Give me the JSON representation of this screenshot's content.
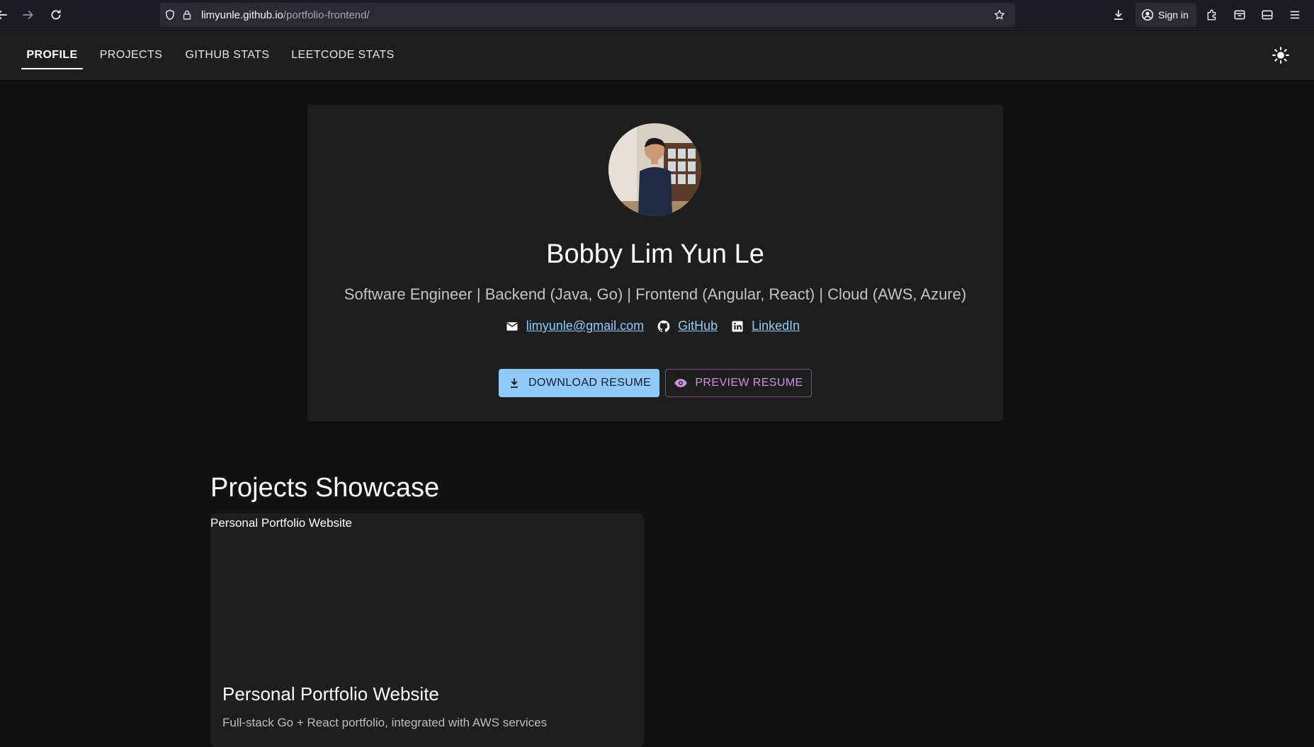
{
  "browser": {
    "url_domain": "limyunle.github.io",
    "url_path": "/portfolio-frontend/",
    "signin_label": "Sign in"
  },
  "nav": {
    "tabs": [
      {
        "label": "PROFILE",
        "active": true
      },
      {
        "label": "PROJECTS",
        "active": false
      },
      {
        "label": "GITHUB STATS",
        "active": false
      },
      {
        "label": "LEETCODE STATS",
        "active": false
      }
    ]
  },
  "profile": {
    "name": "Bobby Lim Yun Le",
    "tagline": "Software Engineer | Backend (Java, Go) | Frontend (Angular, React) | Cloud (AWS, Azure)",
    "email": "limyunle@gmail.com",
    "github_label": "GitHub",
    "linkedin_label": "LinkedIn",
    "download_label": "DOWNLOAD RESUME",
    "preview_label": "PREVIEW RESUME"
  },
  "projects": {
    "heading": "Projects Showcase",
    "items": [
      {
        "image_alt": "Personal Portfolio Website",
        "title": "Personal Portfolio Website",
        "description": "Full-stack Go + React portfolio, integrated with AWS services"
      }
    ]
  },
  "colors": {
    "background": "#121212",
    "surface": "#1e1e1e",
    "primary": "#90caf9",
    "secondary": "#ce93d8"
  }
}
